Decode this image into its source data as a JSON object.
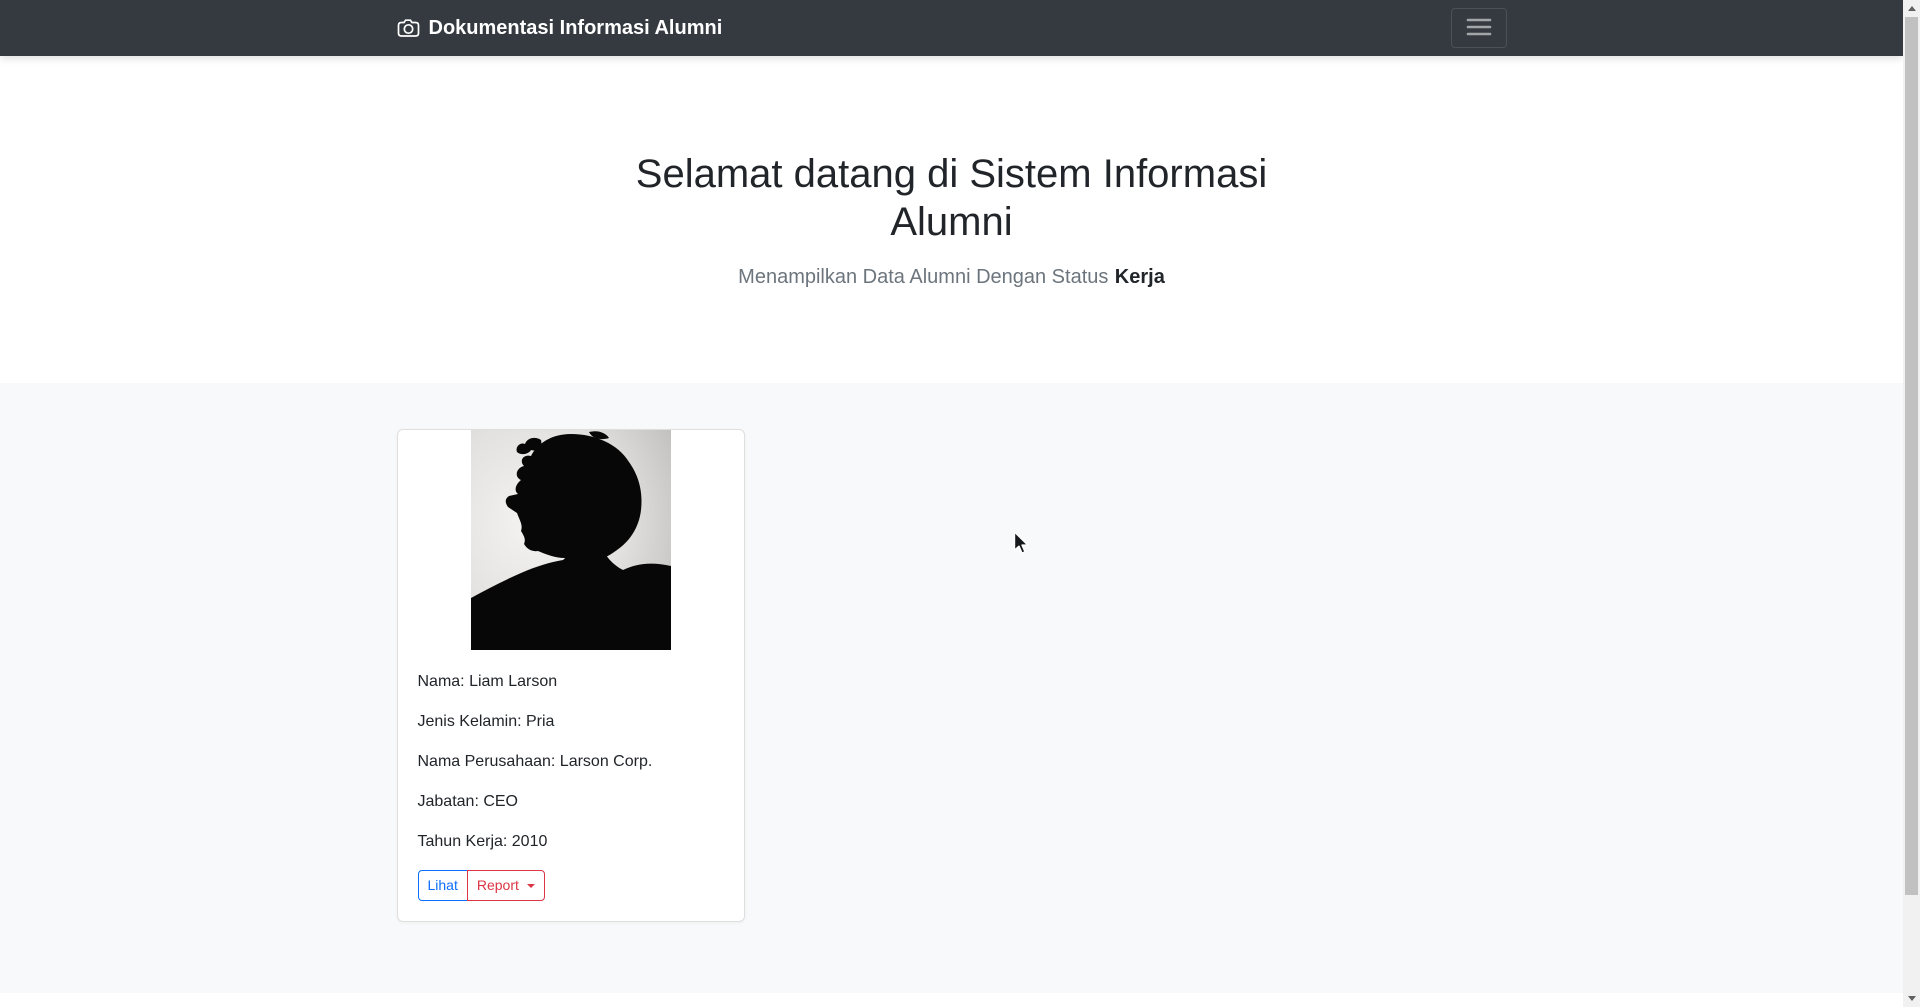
{
  "navbar": {
    "brand": "Dokumentasi Informasi Alumni",
    "background": "#343a40"
  },
  "hero": {
    "title": "Selamat datang di Sistem Informasi Alumni",
    "subtitle_prefix": "Menampilkan Data Alumni Dengan Status",
    "subtitle_status": "Kerja"
  },
  "alumni_card": {
    "photo": "black-silhouette-portrait-of-man-with-curly-hair-and-glasses",
    "fields": [
      {
        "text": "Nama: Liam Larson"
      },
      {
        "text": "Jenis Kelamin: Pria"
      },
      {
        "text": "Nama Perusahaan: Larson Corp."
      },
      {
        "text": "Jabatan: CEO"
      },
      {
        "text": "Tahun Kerja: 2010"
      }
    ],
    "view_button": "Lihat",
    "report_button": "Report"
  },
  "colors": {
    "primary": "#0d6efd",
    "danger": "#dc3545",
    "navbar_bg": "#343a40",
    "section_bg": "#f8f9fa",
    "text": "#212529",
    "muted": "#6c757d"
  }
}
